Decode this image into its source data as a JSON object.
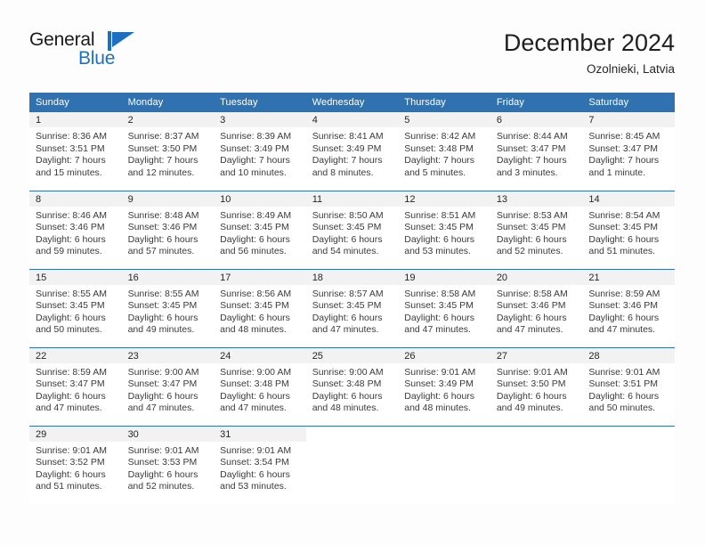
{
  "brand": {
    "name_part1": "General",
    "name_part2": "Blue",
    "flag_icon": "triangle-flag-icon",
    "accent_color": "#1f6fc0"
  },
  "header": {
    "title": "December 2024",
    "subtitle": "Ozolnieki, Latvia"
  },
  "theme": {
    "header_blue": "#3071b0",
    "daynum_band": "#f2f2f2",
    "body_text": "#3a3a3a"
  },
  "weekday_headers": [
    "Sunday",
    "Monday",
    "Tuesday",
    "Wednesday",
    "Thursday",
    "Friday",
    "Saturday"
  ],
  "labels": {
    "sunrise_prefix": "Sunrise:",
    "sunset_prefix": "Sunset:",
    "daylight_prefix": "Daylight:"
  },
  "weeks": [
    [
      {
        "day": "1",
        "sunrise": "Sunrise: 8:36 AM",
        "sunset": "Sunset: 3:51 PM",
        "daylight_line1": "Daylight: 7 hours",
        "daylight_line2": "and 15 minutes."
      },
      {
        "day": "2",
        "sunrise": "Sunrise: 8:37 AM",
        "sunset": "Sunset: 3:50 PM",
        "daylight_line1": "Daylight: 7 hours",
        "daylight_line2": "and 12 minutes."
      },
      {
        "day": "3",
        "sunrise": "Sunrise: 8:39 AM",
        "sunset": "Sunset: 3:49 PM",
        "daylight_line1": "Daylight: 7 hours",
        "daylight_line2": "and 10 minutes."
      },
      {
        "day": "4",
        "sunrise": "Sunrise: 8:41 AM",
        "sunset": "Sunset: 3:49 PM",
        "daylight_line1": "Daylight: 7 hours",
        "daylight_line2": "and 8 minutes."
      },
      {
        "day": "5",
        "sunrise": "Sunrise: 8:42 AM",
        "sunset": "Sunset: 3:48 PM",
        "daylight_line1": "Daylight: 7 hours",
        "daylight_line2": "and 5 minutes."
      },
      {
        "day": "6",
        "sunrise": "Sunrise: 8:44 AM",
        "sunset": "Sunset: 3:47 PM",
        "daylight_line1": "Daylight: 7 hours",
        "daylight_line2": "and 3 minutes."
      },
      {
        "day": "7",
        "sunrise": "Sunrise: 8:45 AM",
        "sunset": "Sunset: 3:47 PM",
        "daylight_line1": "Daylight: 7 hours",
        "daylight_line2": "and 1 minute."
      }
    ],
    [
      {
        "day": "8",
        "sunrise": "Sunrise: 8:46 AM",
        "sunset": "Sunset: 3:46 PM",
        "daylight_line1": "Daylight: 6 hours",
        "daylight_line2": "and 59 minutes."
      },
      {
        "day": "9",
        "sunrise": "Sunrise: 8:48 AM",
        "sunset": "Sunset: 3:46 PM",
        "daylight_line1": "Daylight: 6 hours",
        "daylight_line2": "and 57 minutes."
      },
      {
        "day": "10",
        "sunrise": "Sunrise: 8:49 AM",
        "sunset": "Sunset: 3:45 PM",
        "daylight_line1": "Daylight: 6 hours",
        "daylight_line2": "and 56 minutes."
      },
      {
        "day": "11",
        "sunrise": "Sunrise: 8:50 AM",
        "sunset": "Sunset: 3:45 PM",
        "daylight_line1": "Daylight: 6 hours",
        "daylight_line2": "and 54 minutes."
      },
      {
        "day": "12",
        "sunrise": "Sunrise: 8:51 AM",
        "sunset": "Sunset: 3:45 PM",
        "daylight_line1": "Daylight: 6 hours",
        "daylight_line2": "and 53 minutes."
      },
      {
        "day": "13",
        "sunrise": "Sunrise: 8:53 AM",
        "sunset": "Sunset: 3:45 PM",
        "daylight_line1": "Daylight: 6 hours",
        "daylight_line2": "and 52 minutes."
      },
      {
        "day": "14",
        "sunrise": "Sunrise: 8:54 AM",
        "sunset": "Sunset: 3:45 PM",
        "daylight_line1": "Daylight: 6 hours",
        "daylight_line2": "and 51 minutes."
      }
    ],
    [
      {
        "day": "15",
        "sunrise": "Sunrise: 8:55 AM",
        "sunset": "Sunset: 3:45 PM",
        "daylight_line1": "Daylight: 6 hours",
        "daylight_line2": "and 50 minutes."
      },
      {
        "day": "16",
        "sunrise": "Sunrise: 8:55 AM",
        "sunset": "Sunset: 3:45 PM",
        "daylight_line1": "Daylight: 6 hours",
        "daylight_line2": "and 49 minutes."
      },
      {
        "day": "17",
        "sunrise": "Sunrise: 8:56 AM",
        "sunset": "Sunset: 3:45 PM",
        "daylight_line1": "Daylight: 6 hours",
        "daylight_line2": "and 48 minutes."
      },
      {
        "day": "18",
        "sunrise": "Sunrise: 8:57 AM",
        "sunset": "Sunset: 3:45 PM",
        "daylight_line1": "Daylight: 6 hours",
        "daylight_line2": "and 47 minutes."
      },
      {
        "day": "19",
        "sunrise": "Sunrise: 8:58 AM",
        "sunset": "Sunset: 3:45 PM",
        "daylight_line1": "Daylight: 6 hours",
        "daylight_line2": "and 47 minutes."
      },
      {
        "day": "20",
        "sunrise": "Sunrise: 8:58 AM",
        "sunset": "Sunset: 3:46 PM",
        "daylight_line1": "Daylight: 6 hours",
        "daylight_line2": "and 47 minutes."
      },
      {
        "day": "21",
        "sunrise": "Sunrise: 8:59 AM",
        "sunset": "Sunset: 3:46 PM",
        "daylight_line1": "Daylight: 6 hours",
        "daylight_line2": "and 47 minutes."
      }
    ],
    [
      {
        "day": "22",
        "sunrise": "Sunrise: 8:59 AM",
        "sunset": "Sunset: 3:47 PM",
        "daylight_line1": "Daylight: 6 hours",
        "daylight_line2": "and 47 minutes."
      },
      {
        "day": "23",
        "sunrise": "Sunrise: 9:00 AM",
        "sunset": "Sunset: 3:47 PM",
        "daylight_line1": "Daylight: 6 hours",
        "daylight_line2": "and 47 minutes."
      },
      {
        "day": "24",
        "sunrise": "Sunrise: 9:00 AM",
        "sunset": "Sunset: 3:48 PM",
        "daylight_line1": "Daylight: 6 hours",
        "daylight_line2": "and 47 minutes."
      },
      {
        "day": "25",
        "sunrise": "Sunrise: 9:00 AM",
        "sunset": "Sunset: 3:48 PM",
        "daylight_line1": "Daylight: 6 hours",
        "daylight_line2": "and 48 minutes."
      },
      {
        "day": "26",
        "sunrise": "Sunrise: 9:01 AM",
        "sunset": "Sunset: 3:49 PM",
        "daylight_line1": "Daylight: 6 hours",
        "daylight_line2": "and 48 minutes."
      },
      {
        "day": "27",
        "sunrise": "Sunrise: 9:01 AM",
        "sunset": "Sunset: 3:50 PM",
        "daylight_line1": "Daylight: 6 hours",
        "daylight_line2": "and 49 minutes."
      },
      {
        "day": "28",
        "sunrise": "Sunrise: 9:01 AM",
        "sunset": "Sunset: 3:51 PM",
        "daylight_line1": "Daylight: 6 hours",
        "daylight_line2": "and 50 minutes."
      }
    ],
    [
      {
        "day": "29",
        "sunrise": "Sunrise: 9:01 AM",
        "sunset": "Sunset: 3:52 PM",
        "daylight_line1": "Daylight: 6 hours",
        "daylight_line2": "and 51 minutes."
      },
      {
        "day": "30",
        "sunrise": "Sunrise: 9:01 AM",
        "sunset": "Sunset: 3:53 PM",
        "daylight_line1": "Daylight: 6 hours",
        "daylight_line2": "and 52 minutes."
      },
      {
        "day": "31",
        "sunrise": "Sunrise: 9:01 AM",
        "sunset": "Sunset: 3:54 PM",
        "daylight_line1": "Daylight: 6 hours",
        "daylight_line2": "and 53 minutes."
      },
      {
        "day": "",
        "sunrise": "",
        "sunset": "",
        "daylight_line1": "",
        "daylight_line2": ""
      },
      {
        "day": "",
        "sunrise": "",
        "sunset": "",
        "daylight_line1": "",
        "daylight_line2": ""
      },
      {
        "day": "",
        "sunrise": "",
        "sunset": "",
        "daylight_line1": "",
        "daylight_line2": ""
      },
      {
        "day": "",
        "sunrise": "",
        "sunset": "",
        "daylight_line1": "",
        "daylight_line2": ""
      }
    ]
  ]
}
